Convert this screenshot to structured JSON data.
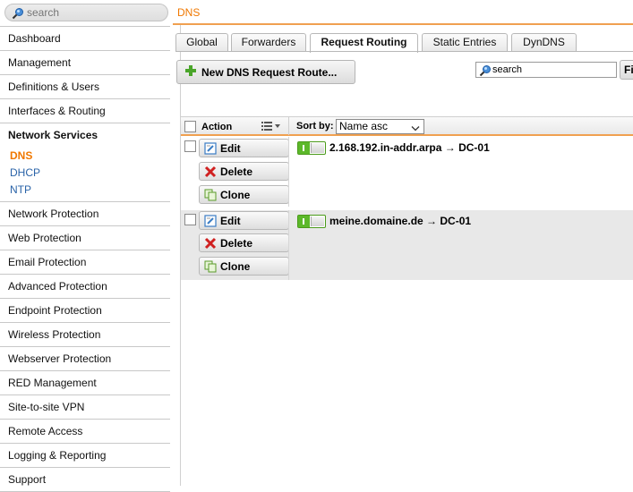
{
  "search": {
    "placeholder": "search"
  },
  "sidebar": {
    "items_top": [
      "Dashboard",
      "Management",
      "Definitions & Users",
      "Interfaces & Routing"
    ],
    "group": {
      "title": "Network Services",
      "subitems": [
        "DNS",
        "DHCP",
        "NTP"
      ],
      "active": "DNS"
    },
    "items_bottom": [
      "Network Protection",
      "Web Protection",
      "Email Protection",
      "Advanced Protection",
      "Endpoint Protection",
      "Wireless Protection",
      "Webserver Protection",
      "RED Management",
      "Site-to-site VPN",
      "Remote Access",
      "Logging & Reporting",
      "Support"
    ]
  },
  "page": {
    "title": "DNS"
  },
  "tabs": [
    "Global",
    "Forwarders",
    "Request Routing",
    "Static Entries",
    "DynDNS"
  ],
  "active_tab": "Request Routing",
  "toolbar": {
    "new_button_label": "New DNS Request Route...",
    "filter_value": "search",
    "find_label": "Fi"
  },
  "list": {
    "header": {
      "action_label": "Action",
      "sort_by_label": "Sort by:",
      "sort_value": "Name asc"
    },
    "actions": [
      "Edit",
      "Delete",
      "Clone"
    ],
    "rows": [
      {
        "label": "2.168.192.in-addr.arpa → DC-01",
        "enabled": true
      },
      {
        "label": "meine.domaine.de → DC-01",
        "enabled": true
      }
    ]
  },
  "colors": {
    "accent": "#f07800",
    "link": "#2a63a8",
    "toggle_on": "#5cb82a",
    "row_alt": "#e8e8e8"
  }
}
